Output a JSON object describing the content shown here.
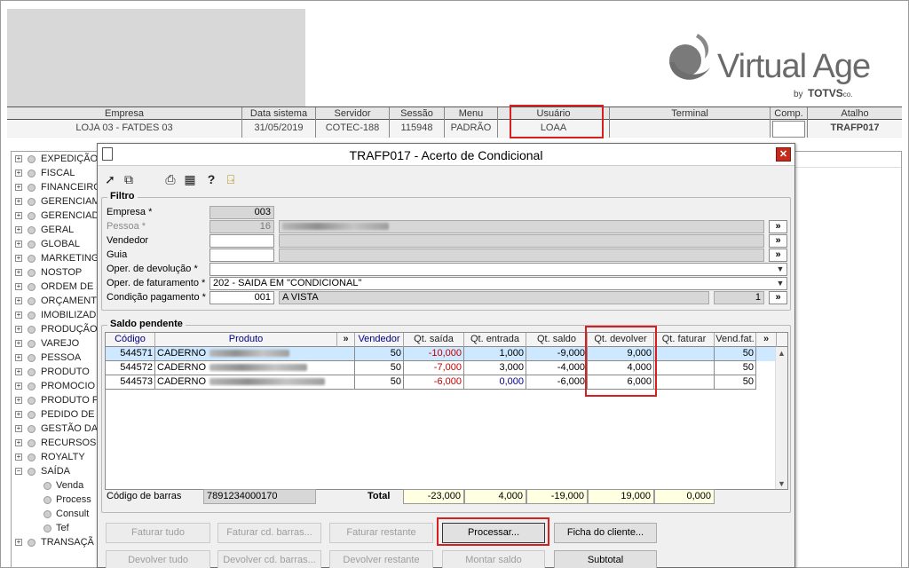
{
  "brand": {
    "name": "Virtual Age",
    "by": "by",
    "partner": "TOTVS",
    "partner_suffix": "co."
  },
  "infobar": {
    "columns": [
      {
        "header": "Empresa",
        "value": "LOJA 03 - FATDES 03"
      },
      {
        "header": "Data sistema",
        "value": "31/05/2019"
      },
      {
        "header": "Servidor",
        "value": "COTEC-188"
      },
      {
        "header": "Sessão",
        "value": "115948"
      },
      {
        "header": "Menu",
        "value": "PADRÃO"
      },
      {
        "header": "Usuário",
        "value": "LOAA"
      },
      {
        "header": "Terminal",
        "value": ""
      },
      {
        "header": "Comp.",
        "value": ""
      },
      {
        "header": "Atalho",
        "value": "TRAFP017"
      }
    ]
  },
  "tree": {
    "items": [
      "EXPEDIÇÃO",
      "FISCAL",
      "FINANCEIRO",
      "GERENCIAM",
      "GERENCIAD",
      "GERAL",
      "GLOBAL",
      "MARKETING",
      "NOSTOP",
      "ORDEM DE S",
      "ORÇAMENT",
      "IMOBILIZAD",
      "PRODUÇÃO",
      "VAREJO",
      "PESSOA",
      "PRODUTO",
      "PROMOCIO",
      "PRODUTO F",
      "PEDIDO DE V",
      "GESTÃO DA",
      "RECURSOS",
      "ROYALTY",
      "SAÍDA"
    ],
    "children": [
      "Venda",
      "Process",
      "Consult",
      "Tef"
    ],
    "last": "TRANSAÇÃ"
  },
  "dialog": {
    "title": "TRAFP017 - Acerto de Condicional",
    "close": "✕",
    "filtro": {
      "legend": "Filtro",
      "empresa_label": "Empresa *",
      "empresa_value": "003",
      "pessoa_label": "Pessoa *",
      "pessoa_value": "16",
      "vendedor_label": "Vendedor",
      "guia_label": "Guia",
      "oper_dev_label": "Oper. de devolução *",
      "oper_dev_value": "",
      "oper_fat_label": "Oper. de faturamento *",
      "oper_fat_value": "202 - SAIDA EM \"CONDICIONAL\"",
      "cond_label": "Condição pagamento *",
      "cond_code": "001",
      "cond_desc": "A VISTA",
      "cond_num": "1",
      "search_btn": "»"
    },
    "saldo": {
      "legend": "Saldo pendente",
      "columns": [
        "Código",
        "Produto",
        "»",
        "Vendedor",
        "Qt. saída",
        "Qt. entrada",
        "Qt. saldo",
        "Qt. devolver",
        "Qt. faturar",
        "Vend.fat.",
        "»"
      ],
      "rows": [
        {
          "codigo": "544571",
          "produto": "CADERNO",
          "vendedor": "50",
          "saida": "-10,000",
          "entrada": "1,000",
          "saldo": "-9,000",
          "devolver": "9,000",
          "faturar": "",
          "vendfat": "50"
        },
        {
          "codigo": "544572",
          "produto": "CADERNO",
          "vendedor": "50",
          "saida": "-7,000",
          "entrada": "3,000",
          "saldo": "-4,000",
          "devolver": "4,000",
          "faturar": "",
          "vendfat": "50"
        },
        {
          "codigo": "544573",
          "produto": "CADERNO",
          "vendedor": "50",
          "saida": "-6,000",
          "entrada": "0,000",
          "saldo": "-6,000",
          "devolver": "6,000",
          "faturar": "",
          "vendfat": "50"
        }
      ]
    },
    "barcode_label": "Código de barras",
    "barcode_value": "7891234000170",
    "total_label": "Total",
    "totals": {
      "saida": "-23,000",
      "entrada": "4,000",
      "saldo": "-19,000",
      "devolver": "19,000",
      "faturar": "0,000"
    },
    "buttons": {
      "faturar_tudo": "Faturar tudo",
      "faturar_barras": "Faturar cd. barras...",
      "faturar_restante": "Faturar restante",
      "processar": "Processar...",
      "ficha_cliente": "Ficha do cliente...",
      "devolver_tudo": "Devolver tudo",
      "devolver_barras": "Devolver cd. barras...",
      "devolver_restante": "Devolver restante",
      "montar_saldo": "Montar saldo",
      "subtotal": "Subtotal"
    }
  },
  "colors": {
    "highlight_red": "#d81f1f",
    "selected_row": "#cde8ff",
    "negative": "#c00000",
    "blue_value": "#00008b",
    "total_bg": "#ffffe1"
  }
}
